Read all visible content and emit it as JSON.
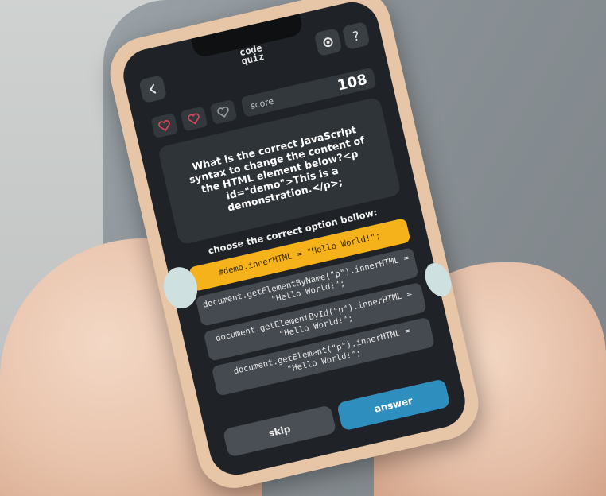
{
  "app": {
    "logo_top": "code",
    "logo_bottom": "quiz",
    "back_icon": "chevron-left-icon",
    "settings_icon": "gear-icon",
    "help_label": "?"
  },
  "status": {
    "lives": [
      {
        "icon": "heart-icon",
        "color": "#e0455a"
      },
      {
        "icon": "heart-icon",
        "color": "#e0455a"
      },
      {
        "icon": "heart-icon",
        "color": "#9aa0a6"
      }
    ],
    "score_label": "score",
    "score_value": "108"
  },
  "question": {
    "text": "What is the correct JavaScript syntax to change the content of the HTML element below?<p id=\"demo\">This is a demonstration.</p>;"
  },
  "prompt": "choose the correct option bellow:",
  "options": [
    {
      "text": "#demo.innerHTML = \"Hello World!\";",
      "selected": true
    },
    {
      "text": "document.getElementByName(\"p\").innerHTML = \"Hello World!\";",
      "selected": false
    },
    {
      "text": "document.getElementById(\"p\").innerHTML = \"Hello World!\";",
      "selected": false
    },
    {
      "text": "document.getElement(\"p\").innerHTML = \"Hello World!\";",
      "selected": false
    }
  ],
  "actions": {
    "skip_label": "skip",
    "answer_label": "answer"
  },
  "colors": {
    "accent": "#f6b21a",
    "primary_button": "#2e8fbf",
    "screen_bg": "#1f2327"
  }
}
